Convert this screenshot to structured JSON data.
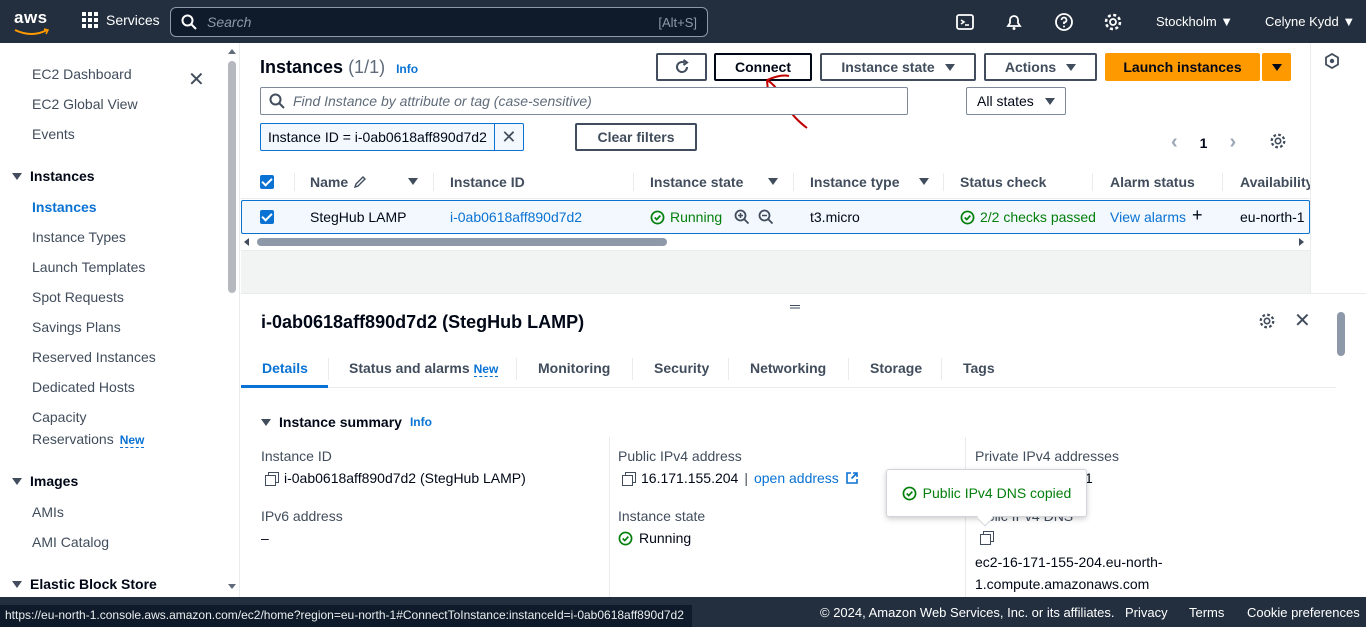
{
  "topnav": {
    "logo_text": "aws",
    "services": "Services",
    "search_placeholder": "Search",
    "search_shortcut": "[Alt+S]",
    "region": "Stockholm ▼",
    "user": "Celyne Kydd ▼"
  },
  "sidebar": {
    "items": [
      "EC2 Dashboard",
      "EC2 Global View",
      "Events"
    ],
    "instances_header": "Instances",
    "instances_items": [
      "Instances",
      "Instance Types",
      "Launch Templates",
      "Spot Requests",
      "Savings Plans",
      "Reserved Instances",
      "Dedicated Hosts",
      "Capacity",
      "Reservations"
    ],
    "capacity_badge": "New",
    "images_header": "Images",
    "images_items": [
      "AMIs",
      "AMI Catalog"
    ],
    "ebs_header": "Elastic Block Store"
  },
  "main": {
    "title": "Instances",
    "count": "(1/1)",
    "info": "Info",
    "connect": "Connect",
    "instance_state_btn": "Instance state",
    "actions_btn": "Actions",
    "launch_btn": "Launch instances",
    "find_placeholder": "Find Instance by attribute or tag (case-sensitive)",
    "all_states": "All states",
    "filter_token": "Instance ID = i-0ab0618aff890d7d2",
    "clear_filters": "Clear filters",
    "page": "1"
  },
  "table": {
    "headers": [
      "Name",
      "Instance ID",
      "Instance state",
      "Instance type",
      "Status check",
      "Alarm status",
      "Availability"
    ],
    "row": {
      "name": "StegHub LAMP",
      "instance_id": "i-0ab0618aff890d7d2",
      "state": "Running",
      "type": "t3.micro",
      "status": "2/2 checks passed",
      "alarm": "View alarms",
      "az": "eu-north-1"
    }
  },
  "details": {
    "title": "i-0ab0618aff890d7d2 (StegHub LAMP)",
    "tabs": [
      "Details",
      "Status and alarms",
      "Monitoring",
      "Security",
      "Networking",
      "Storage",
      "Tags"
    ],
    "tab_badge": "New",
    "section": "Instance summary",
    "section_info": "Info",
    "instance_id_label": "Instance ID",
    "instance_id_value": "i-0ab0618aff890d7d2 (StegHub LAMP)",
    "ipv6_label": "IPv6 address",
    "ipv6_value": "–",
    "public_ipv4_label": "Public IPv4 address",
    "public_ipv4_value": "16.171.155.204",
    "open_address": "open address",
    "state_label": "Instance state",
    "state_value": "Running",
    "private_ipv4_label": "Private IPv4 addresses",
    "private_ipv4_value_partial": "1",
    "public_dns_label_partial": "ublic IPv4 DNS",
    "public_dns_value_1": "ec2-16-171-155-204.eu-north-",
    "public_dns_value_2": "1.compute.amazonaws.com",
    "popover": "Public IPv4 DNS copied"
  },
  "footer": {
    "url": "https://eu-north-1.console.aws.amazon.com/ec2/home?region=eu-north-1#ConnectToInstance:instanceId=i-0ab0618aff890d7d2",
    "copyright": "© 2024, Amazon Web Services, Inc. or its affiliates.",
    "privacy": "Privacy",
    "terms": "Terms",
    "cookies": "Cookie preferences"
  },
  "colors": {
    "nav_bg": "#232f3e",
    "accent": "#0972d3",
    "primary": "#ff9900",
    "success": "#037f0c"
  }
}
